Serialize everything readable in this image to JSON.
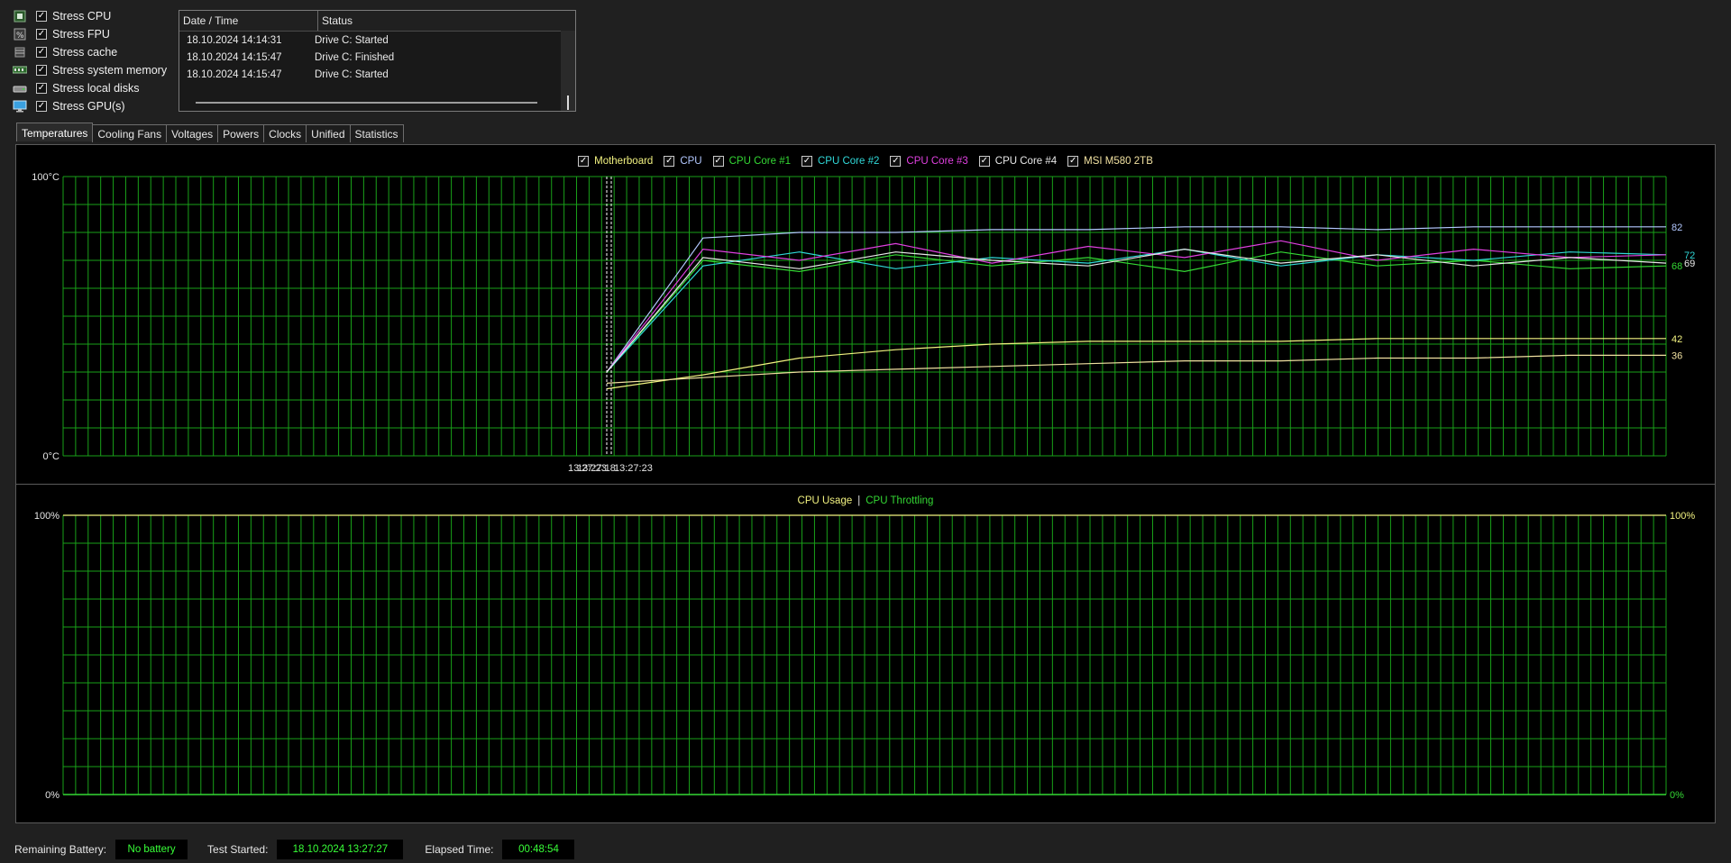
{
  "stress_options": [
    {
      "label": "Stress CPU",
      "checked": true,
      "icon": "cpu-chip-icon"
    },
    {
      "label": "Stress FPU",
      "checked": true,
      "icon": "fpu-chip-icon"
    },
    {
      "label": "Stress cache",
      "checked": true,
      "icon": "cache-icon"
    },
    {
      "label": "Stress system memory",
      "checked": true,
      "icon": "memory-module-icon"
    },
    {
      "label": "Stress local disks",
      "checked": true,
      "icon": "disk-drive-icon"
    },
    {
      "label": "Stress GPU(s)",
      "checked": true,
      "icon": "gpu-monitor-icon"
    }
  ],
  "log": {
    "columns": [
      "Date / Time",
      "Status"
    ],
    "rows": [
      {
        "time": "18.10.2024 14:14:31",
        "status": "Drive C: Started"
      },
      {
        "time": "18.10.2024 14:15:47",
        "status": "Drive C: Finished"
      },
      {
        "time": "18.10.2024 14:15:47",
        "status": "Drive C: Started"
      }
    ]
  },
  "tabs": [
    {
      "label": "Temperatures",
      "active": true
    },
    {
      "label": "Cooling Fans",
      "active": false
    },
    {
      "label": "Voltages",
      "active": false
    },
    {
      "label": "Powers",
      "active": false
    },
    {
      "label": "Clocks",
      "active": false
    },
    {
      "label": "Unified",
      "active": false
    },
    {
      "label": "Statistics",
      "active": false
    }
  ],
  "colors": {
    "grid": "#19a019",
    "motherboard": "#f2f280",
    "cpu": "#b3c8ff",
    "core1": "#34d834",
    "core2": "#30d8d8",
    "core3": "#e040e0",
    "core4": "#e8e8e8",
    "msi": "#f0e0a0",
    "usage": "#f2f280",
    "throttle": "#34d834",
    "status_value": "#38ff38"
  },
  "chart_data": [
    {
      "type": "line",
      "y_unit": "°C",
      "y_max_label": "100°C",
      "y_min_label": "0°C",
      "ylim": [
        0,
        100
      ],
      "x_labels": [
        "13:27:23",
        "13:27:18",
        "13:27:23"
      ],
      "series": [
        {
          "name": "Motherboard",
          "checked": true,
          "final_value": 42,
          "values": [
            24,
            29,
            35,
            38,
            40,
            41,
            41,
            41,
            42,
            42,
            42,
            42
          ]
        },
        {
          "name": "CPU",
          "checked": true,
          "final_value": 82,
          "values": [
            30,
            78,
            80,
            80,
            81,
            81,
            82,
            82,
            81,
            82,
            82,
            82
          ]
        },
        {
          "name": "CPU Core #1",
          "checked": true,
          "final_value": 68,
          "values": [
            30,
            70,
            66,
            72,
            68,
            71,
            66,
            73,
            68,
            70,
            67,
            68
          ]
        },
        {
          "name": "CPU Core #2",
          "checked": true,
          "final_value": 72,
          "values": [
            30,
            68,
            73,
            67,
            71,
            69,
            74,
            68,
            72,
            70,
            73,
            72
          ]
        },
        {
          "name": "CPU Core #3",
          "checked": true,
          "final_value": 72,
          "values": [
            30,
            74,
            70,
            76,
            69,
            75,
            71,
            77,
            70,
            74,
            71,
            72
          ]
        },
        {
          "name": "CPU Core #4",
          "checked": true,
          "final_value": 69,
          "values": [
            30,
            71,
            67,
            73,
            70,
            68,
            74,
            69,
            72,
            68,
            71,
            69
          ]
        },
        {
          "name": "MSI M580 2TB",
          "checked": true,
          "final_value": 36,
          "values": [
            26,
            28,
            30,
            31,
            32,
            33,
            34,
            34,
            35,
            35,
            36,
            36
          ]
        }
      ],
      "right_labels": [
        "82",
        "72",
        "69",
        "68",
        "42",
        "36"
      ],
      "grid": true,
      "legend": "top-center"
    },
    {
      "type": "line",
      "y_max_label": "100%",
      "y_min_label": "0%",
      "right_max_label": "100%",
      "right_min_label": "0%",
      "ylim": [
        0,
        100
      ],
      "series": [
        {
          "name": "CPU Usage",
          "values": []
        },
        {
          "name": "CPU Throttling",
          "values": []
        }
      ],
      "legend_separator": "|",
      "grid": true,
      "legend": "top-center"
    }
  ],
  "status": {
    "battery_label": "Remaining Battery:",
    "battery_value": "No battery",
    "started_label": "Test Started:",
    "started_value": "18.10.2024 13:27:27",
    "elapsed_label": "Elapsed Time:",
    "elapsed_value": "00:48:54"
  }
}
